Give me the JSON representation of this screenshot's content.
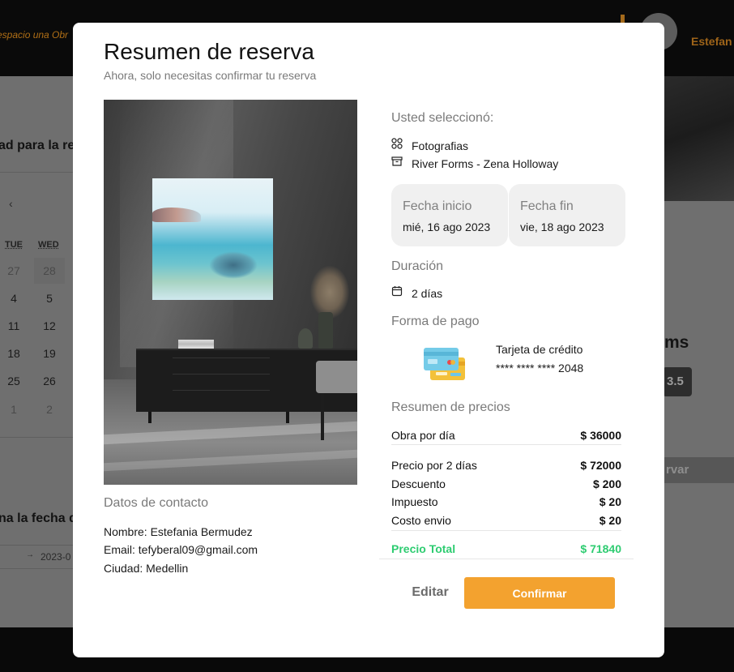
{
  "background": {
    "tagline": "espacio una Obr",
    "user_name": "Estefan",
    "availability_title": "ad para la re",
    "calendar": {
      "prev_icon": "chevron-left-icon",
      "day_names": [
        "TUE",
        "WED"
      ],
      "rows": [
        [
          "27",
          "28"
        ],
        [
          "4",
          "5"
        ],
        [
          "11",
          "12"
        ],
        [
          "18",
          "19"
        ],
        [
          "25",
          "26"
        ],
        [
          "1",
          "2"
        ]
      ]
    },
    "date_title": "na la fecha d",
    "date_field_value": "2023-0",
    "artwork_title_partial": "ms",
    "rating_partial": "3.5",
    "button_partial": "rvar"
  },
  "modal": {
    "title": "Resumen de reserva",
    "subtitle": "Ahora, solo necesitas confirmar tu reserva",
    "contact": {
      "title": "Datos de contacto",
      "name_line": "Nombre: Estefania Bermudez",
      "email_line": "Email: tefyberal09@gmail.com",
      "city_line": "Ciudad: Medellin"
    },
    "selection": {
      "title": "Usted seleccionó:",
      "category": "Fotografias",
      "category_icon": "category-grid-icon",
      "artwork": "River Forms - Zena Holloway",
      "artwork_icon": "archive-box-icon"
    },
    "dates": {
      "start_label": "Fecha inicio",
      "start_value": "mié, 16 ago 2023",
      "end_label": "Fecha fin",
      "end_value": "vie, 18 ago 2023"
    },
    "duration": {
      "title": "Duración",
      "value": "2 días",
      "icon": "calendar-icon"
    },
    "payment": {
      "title": "Forma de pago",
      "method": "Tarjeta de crédito",
      "card_number": "**** **** **** 2048",
      "icon": "credit-cards-icon"
    },
    "prices": {
      "title": "Resumen de precios",
      "per_day_label": "Obra por día",
      "per_day_value": "$ 36000",
      "period_label": "Precio por 2 días",
      "period_value": "$ 72000",
      "discount_label": "Descuento",
      "discount_value": "$ 200",
      "tax_label": "Impuesto",
      "tax_value": "$ 20",
      "shipping_label": "Costo envio",
      "shipping_value": "$ 20",
      "total_label": "Precio Total",
      "total_value": "$ 71840",
      "total_color": "#2ecc71"
    },
    "actions": {
      "edit_label": "Editar",
      "confirm_label": "Confirmar",
      "confirm_color": "#f3a22f"
    }
  }
}
